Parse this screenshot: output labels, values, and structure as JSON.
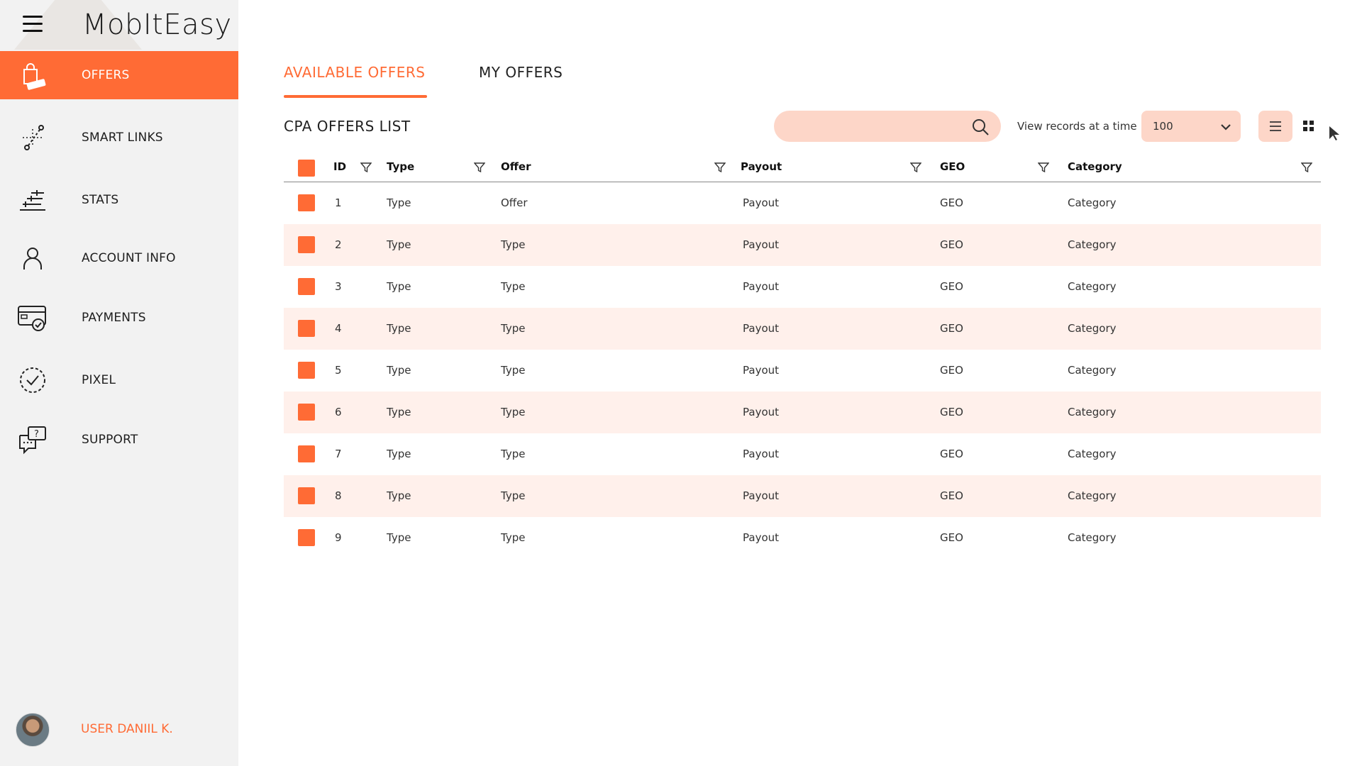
{
  "app": {
    "brand": "MobItEasy"
  },
  "sidebar": {
    "items": [
      {
        "label": "OFFERS",
        "icon": "shopping-bag-icon",
        "active": true
      },
      {
        "label": "SMART LINKS",
        "icon": "link-chain-icon",
        "active": false
      },
      {
        "label": "STATS",
        "icon": "stats-icon",
        "active": false
      },
      {
        "label": "ACCOUNT INFO",
        "icon": "user-icon",
        "active": false
      },
      {
        "label": "PAYMENTS",
        "icon": "payment-card-icon",
        "active": false
      },
      {
        "label": "PIXEL",
        "icon": "pixel-check-icon",
        "active": false
      },
      {
        "label": "SUPPORT",
        "icon": "support-chat-icon",
        "active": false
      }
    ],
    "user": {
      "name": "USER DANIIL K."
    }
  },
  "tabs": [
    {
      "label": "AVAILABLE OFFERS",
      "active": true
    },
    {
      "label": "MY OFFERS",
      "active": false
    }
  ],
  "list": {
    "title": "CPA OFFERS LIST",
    "search": {
      "value": "",
      "placeholder": ""
    },
    "records_label": "View  records at a time",
    "records_value": "100"
  },
  "table": {
    "columns": [
      "ID",
      "Type",
      "Offer",
      "Payout",
      "GEO",
      "Category"
    ],
    "rows": [
      [
        "1",
        "Type",
        "Offer",
        "Payout",
        "GEO",
        "Category"
      ],
      [
        "2",
        "Type",
        "Type",
        "Payout",
        "GEO",
        "Category"
      ],
      [
        "3",
        "Type",
        "Type",
        "Payout",
        "GEO",
        "Category"
      ],
      [
        "4",
        "Type",
        "Type",
        "Payout",
        "GEO",
        "Category"
      ],
      [
        "5",
        "Type",
        "Type",
        "Payout",
        "GEO",
        "Category"
      ],
      [
        "6",
        "Type",
        "Type",
        "Payout",
        "GEO",
        "Category"
      ],
      [
        "7",
        "Type",
        "Type",
        "Payout",
        "GEO",
        "Category"
      ],
      [
        "8",
        "Type",
        "Type",
        "Payout",
        "GEO",
        "Category"
      ],
      [
        "9",
        "Type",
        "Type",
        "Payout",
        "GEO",
        "Category"
      ]
    ]
  },
  "colors": {
    "accent": "#ff6b35",
    "accent_light": "#fdd6c8",
    "row_alt": "#fff0eb",
    "sidebar_bg": "#f2f2f2"
  }
}
